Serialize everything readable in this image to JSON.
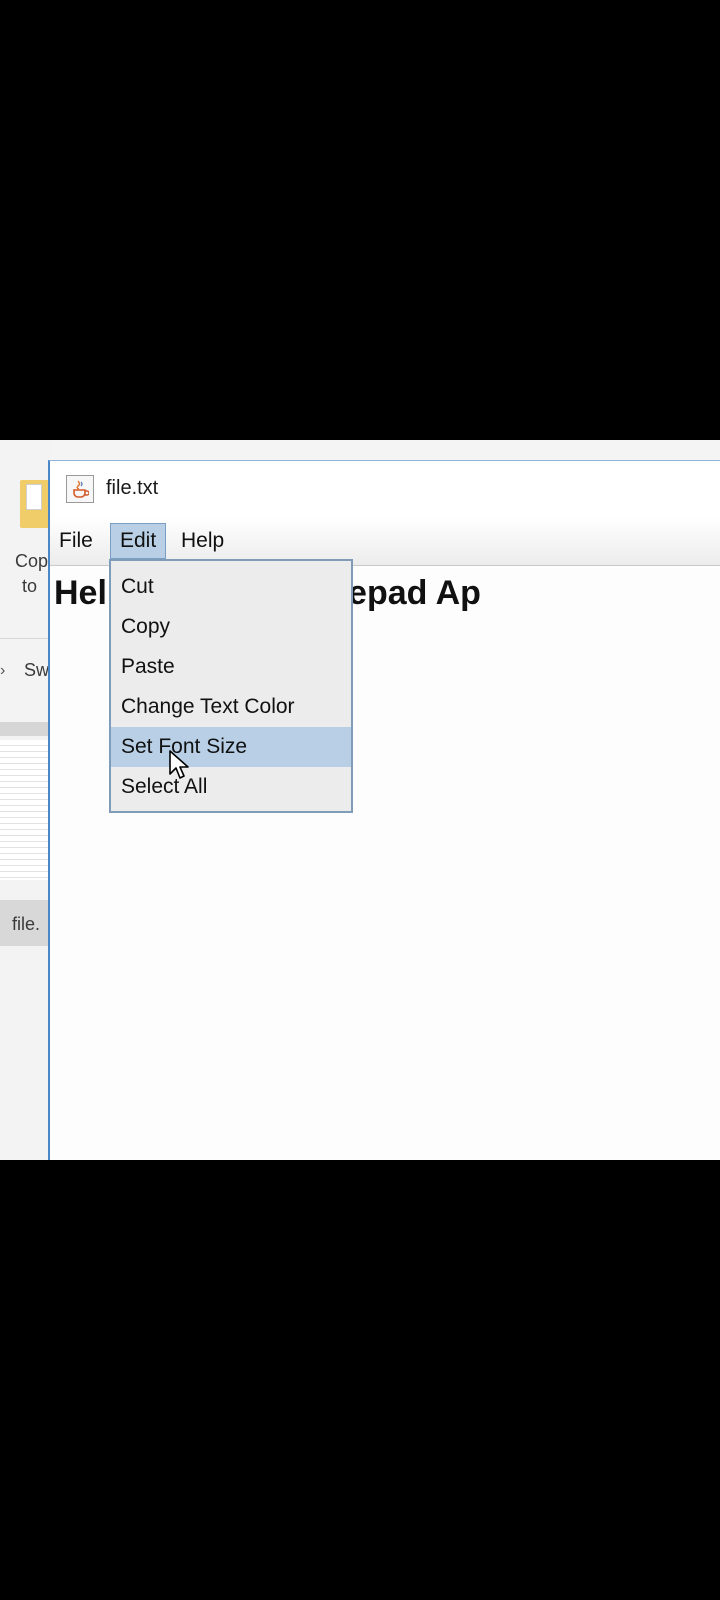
{
  "window": {
    "title": "file.txt",
    "icon": "java-coffee-icon"
  },
  "menubar": {
    "items": [
      {
        "label": "File"
      },
      {
        "label": "Edit",
        "active": true
      },
      {
        "label": "Help"
      }
    ]
  },
  "editor": {
    "text": "Hello This is A notepad Ap"
  },
  "edit_menu": {
    "items": [
      {
        "label": "Cut"
      },
      {
        "label": "Copy"
      },
      {
        "label": "Paste"
      },
      {
        "label": "Change Text Color"
      },
      {
        "label": "Set Font Size",
        "highlighted": true
      },
      {
        "label": "Select All"
      }
    ]
  },
  "background_explorer": {
    "item_line1": "Cop",
    "item_line2": "to",
    "nav_text": "Sw",
    "file_label": "file."
  },
  "colors": {
    "menu_highlight": "#b8cfe5",
    "window_border": "#4a87c8",
    "dropdown_border": "#7f9db9"
  }
}
